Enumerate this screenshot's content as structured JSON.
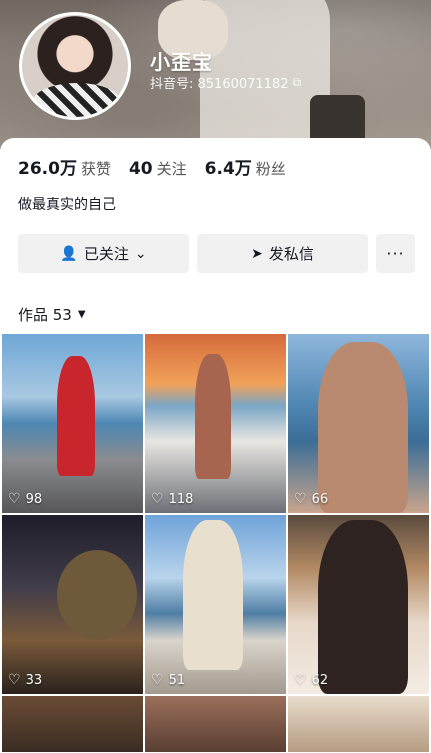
{
  "profile": {
    "nickname": "小歪宝",
    "douyin_id": "抖音号: 85160071182",
    "stats": [
      {
        "num": "26.0万",
        "label": "获赞"
      },
      {
        "num": "40",
        "label": "关注"
      },
      {
        "num": "6.4万",
        "label": "粉丝"
      }
    ],
    "bio": "做最真实的自己"
  },
  "actions": {
    "follow_label": "已关注",
    "message_label": "发私信",
    "more_label": "···"
  },
  "works": {
    "tab_label": "作品 53"
  },
  "tiles": [
    {
      "likes": "98"
    },
    {
      "likes": "118"
    },
    {
      "likes": "66"
    },
    {
      "likes": "33"
    },
    {
      "likes": "51"
    },
    {
      "likes": "62"
    },
    {
      "likes": ""
    },
    {
      "likes": ""
    },
    {
      "likes": ""
    }
  ],
  "icons": {
    "copy": "copy-icon",
    "follow": "user-check-icon",
    "chevron": "chevron-down-icon",
    "message": "paper-plane-icon",
    "more": "more-icon",
    "heart": "heart-outline-icon"
  }
}
